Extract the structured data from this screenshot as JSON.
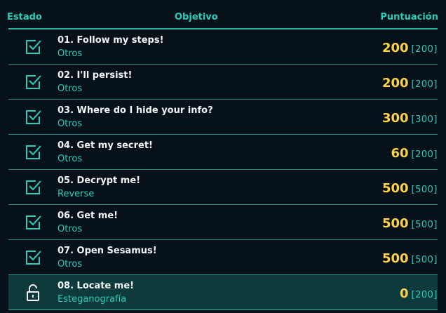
{
  "header": {
    "estado": "Estado",
    "objetivo": "Objetivo",
    "puntuacion": "Puntuación"
  },
  "colors": {
    "background": "#06111a",
    "accent": "#28cdbb",
    "score": "#ffd24a",
    "highlight_row": "#0e3a3b",
    "text": "#f2f5f5"
  },
  "rows": [
    {
      "title": "01. Follow my steps!",
      "category": "Otros",
      "score": "200",
      "max": "[200]",
      "status_icon": "checked-box-icon"
    },
    {
      "title": "02. I'll persist!",
      "category": "Otros",
      "score": "200",
      "max": "[200]",
      "status_icon": "checked-box-icon"
    },
    {
      "title": "03. Where do I hide your info?",
      "category": "Otros",
      "score": "300",
      "max": "[300]",
      "status_icon": "checked-box-icon"
    },
    {
      "title": "04. Get my secret!",
      "category": "Otros",
      "score": "60",
      "max": "[200]",
      "status_icon": "checked-box-icon"
    },
    {
      "title": "05. Decrypt me!",
      "category": "Reverse",
      "score": "500",
      "max": "[500]",
      "status_icon": "checked-box-icon"
    },
    {
      "title": "06. Get me!",
      "category": "Otros",
      "score": "500",
      "max": "[500]",
      "status_icon": "checked-box-icon"
    },
    {
      "title": "07. Open Sesamus!",
      "category": "Otros",
      "score": "500",
      "max": "[500]",
      "status_icon": "checked-box-icon"
    },
    {
      "title": "08. Locate me!",
      "category": "Esteganografía",
      "score": "0",
      "max": "[200]",
      "status_icon": "unlocked-padlock-icon"
    }
  ]
}
